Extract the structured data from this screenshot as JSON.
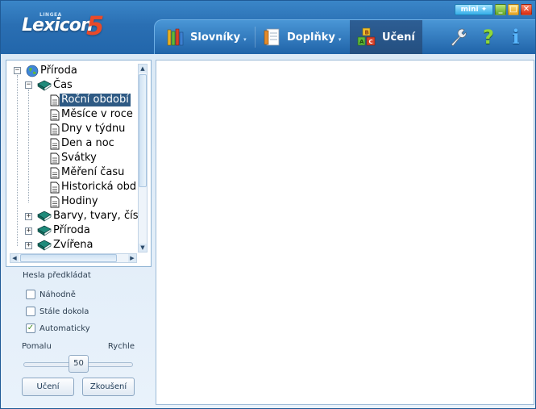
{
  "window": {
    "mini_label": "mini",
    "min_glyph": "_",
    "max_glyph": "□",
    "close_glyph": "✕"
  },
  "logo": {
    "small": "LINGEA",
    "text": "Lexicon",
    "num": "5"
  },
  "nav": {
    "tabs": [
      {
        "label": "Slovníky",
        "icon": "books-icon",
        "dropdown": true
      },
      {
        "label": "Doplňky",
        "icon": "notebook-icon",
        "dropdown": true
      },
      {
        "label": "Učení",
        "icon": "blocks-icon",
        "active": true
      }
    ],
    "caret": "▾",
    "tools": [
      "wrench-icon",
      "help-icon",
      "info-icon"
    ],
    "help_glyph": "?",
    "info_glyph": "i"
  },
  "tree": {
    "root": "Příroda",
    "child": "Čas",
    "items": [
      "Roční období",
      "Měsíce v roce",
      "Dny v týdnu",
      "Den a noc",
      "Svátky",
      "Měření času",
      "Historická obd",
      "Hodiny"
    ],
    "selected_index": 0,
    "siblings": [
      "Barvy, tvary, čís",
      "Příroda",
      "Zvířena"
    ]
  },
  "options": {
    "section_label": "Hesla předkládat",
    "checkboxes": [
      {
        "label": "Náhodně",
        "checked": false
      },
      {
        "label": "Stále dokola",
        "checked": false
      },
      {
        "label": "Automaticky",
        "checked": true
      }
    ],
    "check_glyph": "✓"
  },
  "speed": {
    "left_label": "Pomalu",
    "right_label": "Rychle",
    "value": "50"
  },
  "buttons": {
    "learn": "Učení",
    "test": "Zkoušení"
  }
}
